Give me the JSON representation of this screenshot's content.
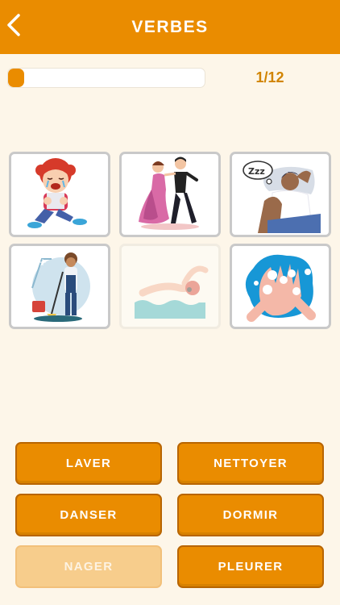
{
  "header": {
    "title": "VERBES",
    "back_icon": "chevron-left-icon"
  },
  "progress": {
    "label": "1/12",
    "current": 1,
    "total": 12
  },
  "colors": {
    "accent": "#ea8c00",
    "background": "#fdf6e9",
    "disabled": "#f7cd8c"
  },
  "cards": [
    {
      "name": "crying-child-card",
      "icon": "crying-icon",
      "state": "active"
    },
    {
      "name": "dancing-couple-card",
      "icon": "dancing-icon",
      "state": "active"
    },
    {
      "name": "sleeping-man-card",
      "icon": "sleeping-icon",
      "state": "active"
    },
    {
      "name": "cleaning-person-card",
      "icon": "cleaning-icon",
      "state": "active"
    },
    {
      "name": "swimmer-card",
      "icon": "swimming-icon",
      "state": "answered"
    },
    {
      "name": "washing-hands-card",
      "icon": "washing-hands-icon",
      "state": "active"
    }
  ],
  "answers": [
    {
      "label": "LAVER",
      "state": "active"
    },
    {
      "label": "NETTOYER",
      "state": "active"
    },
    {
      "label": "DANSER",
      "state": "active"
    },
    {
      "label": "DORMIR",
      "state": "active"
    },
    {
      "label": "NAGER",
      "state": "disabled"
    },
    {
      "label": "PLEURER",
      "state": "active"
    }
  ]
}
